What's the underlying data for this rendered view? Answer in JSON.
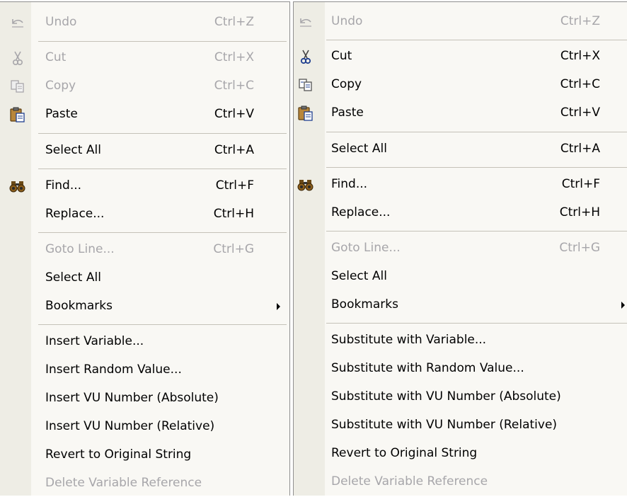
{
  "left_menu": {
    "undo": {
      "label": "Undo",
      "shortcut": "Ctrl+Z",
      "icon": "undo-icon"
    },
    "cut": {
      "label": "Cut",
      "shortcut": "Ctrl+X",
      "icon": "scissors-icon"
    },
    "copy": {
      "label": "Copy",
      "shortcut": "Ctrl+C",
      "icon": "copy-icon"
    },
    "paste": {
      "label": "Paste",
      "shortcut": "Ctrl+V",
      "icon": "clipboard-icon"
    },
    "select_all": {
      "label": "Select All",
      "shortcut": "Ctrl+A"
    },
    "find": {
      "label": "Find...",
      "shortcut": "Ctrl+F",
      "icon": "binoculars-icon"
    },
    "replace": {
      "label": "Replace...",
      "shortcut": "Ctrl+H"
    },
    "goto_line": {
      "label": "Goto Line...",
      "shortcut": "Ctrl+G"
    },
    "select_all_2": {
      "label": "Select All"
    },
    "bookmarks": {
      "label": "Bookmarks"
    },
    "insert_variable": {
      "label": "Insert Variable..."
    },
    "insert_random": {
      "label": "Insert Random Value..."
    },
    "insert_vu_abs": {
      "label": "Insert VU Number (Absolute)"
    },
    "insert_vu_rel": {
      "label": "Insert VU Number (Relative)"
    },
    "revert": {
      "label": "Revert to Original String"
    },
    "delete_var": {
      "label": "Delete Variable Reference"
    }
  },
  "right_menu": {
    "undo": {
      "label": "Undo",
      "shortcut": "Ctrl+Z",
      "icon": "undo-icon"
    },
    "cut": {
      "label": "Cut",
      "shortcut": "Ctrl+X",
      "icon": "scissors-icon"
    },
    "copy": {
      "label": "Copy",
      "shortcut": "Ctrl+C",
      "icon": "copy-icon"
    },
    "paste": {
      "label": "Paste",
      "shortcut": "Ctrl+V",
      "icon": "clipboard-icon"
    },
    "select_all": {
      "label": "Select All",
      "shortcut": "Ctrl+A"
    },
    "find": {
      "label": "Find...",
      "shortcut": "Ctrl+F",
      "icon": "binoculars-icon"
    },
    "replace": {
      "label": "Replace...",
      "shortcut": "Ctrl+H"
    },
    "goto_line": {
      "label": "Goto Line...",
      "shortcut": "Ctrl+G"
    },
    "select_all_2": {
      "label": "Select All"
    },
    "bookmarks": {
      "label": "Bookmarks"
    },
    "subst_variable": {
      "label": "Substitute with Variable..."
    },
    "subst_random": {
      "label": "Substitute with Random Value..."
    },
    "subst_vu_abs": {
      "label": "Substitute with VU Number (Absolute)"
    },
    "subst_vu_rel": {
      "label": "Substitute with VU Number (Relative)"
    },
    "revert": {
      "label": "Revert to Original String"
    },
    "delete_var": {
      "label": "Delete Variable Reference"
    }
  },
  "colors": {
    "menu_background": "#f9f8f4",
    "icon_strip": "#eeede5",
    "disabled_text": "#a7a6aa",
    "separator": "#c5c2b8"
  }
}
